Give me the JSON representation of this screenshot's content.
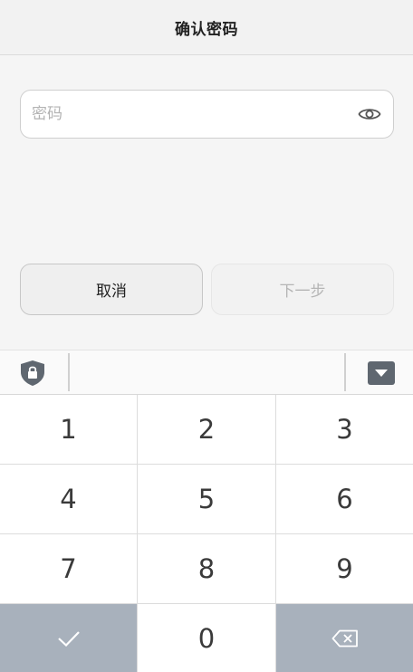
{
  "header": {
    "title": "确认密码"
  },
  "password": {
    "value": "",
    "placeholder": "密码",
    "visibility_icon": "eye-icon"
  },
  "actions": {
    "cancel_label": "取消",
    "next_label": "下一步"
  },
  "keyboard": {
    "toolbar": {
      "secure_icon": "shield-lock-icon",
      "collapse_icon": "keyboard-collapse-icon"
    },
    "keys": [
      "1",
      "2",
      "3",
      "4",
      "5",
      "6",
      "7",
      "8",
      "9"
    ],
    "bottom": {
      "confirm_icon": "checkmark-icon",
      "zero": "0",
      "delete_icon": "backspace-icon"
    },
    "colors": {
      "function_key": "#a8b1bc",
      "digit_key": "#ffffff",
      "icon": "#5f6770"
    }
  }
}
